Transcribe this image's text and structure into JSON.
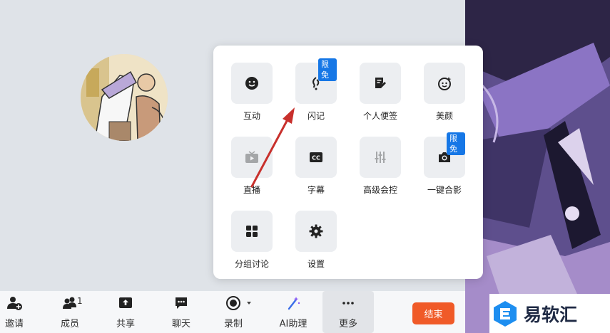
{
  "popup": {
    "items": [
      {
        "label": "互动",
        "icon": "smiley-icon"
      },
      {
        "label": "闪记",
        "icon": "flash-note-icon",
        "badge": "限免"
      },
      {
        "label": "个人便签",
        "icon": "note-edit-icon"
      },
      {
        "label": "美颜",
        "icon": "beauty-face-icon"
      },
      {
        "label": "直播",
        "icon": "live-tv-icon"
      },
      {
        "label": "字幕",
        "icon": "cc-icon"
      },
      {
        "label": "高级会控",
        "icon": "sliders-icon"
      },
      {
        "label": "一键合影",
        "icon": "camera-icon",
        "badge": "限免"
      },
      {
        "label": "分组讨论",
        "icon": "grid-icon"
      },
      {
        "label": "设置",
        "icon": "gear-icon"
      }
    ]
  },
  "toolbar": {
    "items": [
      {
        "label": "邀请",
        "icon": "invite-user-icon"
      },
      {
        "label": "成员",
        "icon": "members-icon",
        "count": "1"
      },
      {
        "label": "共享",
        "icon": "share-screen-icon"
      },
      {
        "label": "聊天",
        "icon": "chat-icon"
      },
      {
        "label": "录制",
        "icon": "record-icon"
      },
      {
        "label": "AI助理",
        "icon": "ai-wand-icon"
      },
      {
        "label": "更多",
        "icon": "more-dots-icon"
      }
    ],
    "end_label": "结束"
  },
  "watermark": {
    "text": "易软汇"
  },
  "colors": {
    "accent": "#1677e6",
    "end": "#f05a28",
    "stage": "#dfe3e8"
  }
}
